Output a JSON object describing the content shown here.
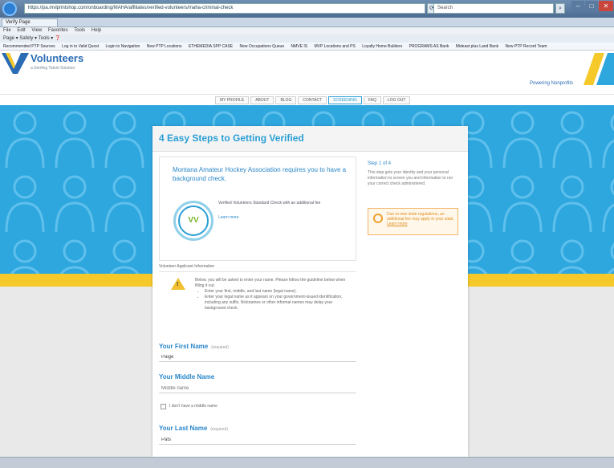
{
  "browser": {
    "address": "https://pa.mvlprintshop.com/onboarding/MAHA/affiliates/verified-volunteers/maha-criminal-check",
    "search_placeholder": "Search",
    "tab_label": "Verify Page",
    "menu": [
      "File",
      "Edit",
      "View",
      "Favorites",
      "Tools",
      "Help"
    ],
    "commands": "Page ▾  Safety ▾  Tools ▾  ❓",
    "favorites": [
      "Recommended PTP Sources",
      "Log in to Valid Quest",
      "Login to Navigation",
      "New PTP Locations",
      "ETHEMEDIA SPP CASE",
      "New Occupations Queue",
      "NMVE IS",
      "MVP Locations and PS",
      "Loyalty Home Builders",
      "PROGRAMS AS Bank",
      "Mideast plus Land Bank",
      "New PTP Record Team"
    ]
  },
  "site": {
    "logo_text": "Volunteers",
    "logo_sub": "a Sterling Talent Solution",
    "header_link": "Powering Nonprofits",
    "nav": [
      "MY PROFILE",
      "ABOUT",
      "BLOG",
      "CONTACT",
      "SCREENING",
      "FAQ",
      "LOG OUT"
    ],
    "active_nav_index": 4
  },
  "card": {
    "title": "4 Easy Steps to Getting Verified",
    "requirement": "Montana Amateur Hockey Association requires you to have a background check.",
    "badge_symbol": "VV",
    "badge_text": "Verified Volunteers Standard Check with an additional fee",
    "badge_link": "Learn more",
    "step_label": "Step 1 of 4",
    "step_text": "This step gets your identity and your personal information to screen you and information to run your correct check administered.",
    "warning_text": "Due to new state regulations, an additional fee may apply in your state.",
    "warning_link": "Learn more",
    "section_label": "Volunteer Applicant Information",
    "instructions_intro": "Below, you will be asked to enter your name. Please follow the guideline below when filling it out.",
    "instructions": [
      "Enter your first, middle, and last name (legal name).",
      "Enter your legal name as it appears on your government-issued identification, including any suffix. Nicknames or other informal names may delay your background check."
    ],
    "fields": [
      {
        "label": "Your First Name",
        "required": "(required)",
        "value": "Paige"
      },
      {
        "label": "Your Middle Name",
        "required": "",
        "value": "Middle name"
      },
      {
        "label": "Your Last Name",
        "required": "(required)",
        "value": "Pats"
      }
    ],
    "no_middle_name": "I don't have a middle name"
  },
  "colors": {
    "hero": "#2ea7df",
    "accent_yellow": "#f5c92a",
    "title_blue": "#2a9fd6"
  }
}
